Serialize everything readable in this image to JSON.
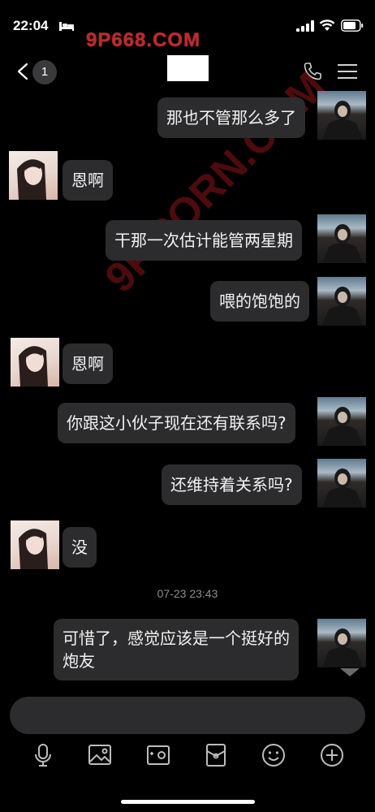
{
  "status_bar": {
    "time": "22:04"
  },
  "watermark": {
    "top": "9P668.COM",
    "diagonal": "9P.PORN.COM"
  },
  "nav": {
    "unread_count": "1"
  },
  "messages": [
    {
      "sender": "me",
      "text": "那也不管那么多了"
    },
    {
      "sender": "her",
      "text": "恩啊"
    },
    {
      "sender": "me",
      "text": "干那一次估计能管两星期"
    },
    {
      "sender": "me",
      "text": "喂的饱饱的"
    },
    {
      "sender": "her",
      "text": "恩啊"
    },
    {
      "sender": "me",
      "text": "你跟这小伙子现在还有联系吗?"
    },
    {
      "sender": "me",
      "text": "还维持着关系吗?"
    },
    {
      "sender": "her",
      "text": "没"
    },
    {
      "sender": "me",
      "text_line1": "可惜了，感觉应该是一个挺好的",
      "text_line2": "炮友"
    }
  ],
  "timestamp": "07-23 23:43",
  "colors": {
    "background": "#000000",
    "bubble": "#2c2c2e",
    "timestamp": "#8e8e93",
    "watermark": "#c0282c"
  },
  "toolbar": {
    "icons": [
      "microphone-icon",
      "image-icon",
      "camera-icon",
      "red-packet-icon",
      "emoji-icon",
      "plus-icon"
    ]
  }
}
